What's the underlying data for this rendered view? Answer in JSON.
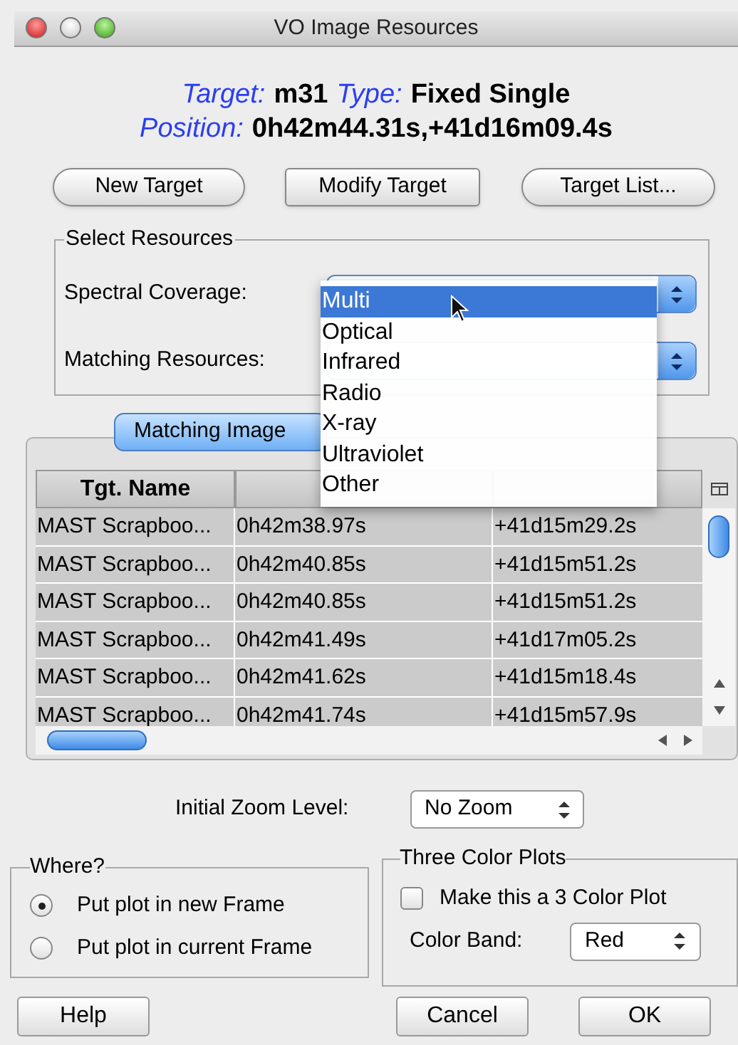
{
  "window": {
    "title": "VO Image Resources"
  },
  "info_lines": [
    [
      {
        "label": "Target:",
        "value": "m31"
      },
      {
        "label": "Type:",
        "value": "Fixed Single"
      }
    ],
    [
      {
        "label": "Position:",
        "value": "0h42m44.31s,+41d16m09.4s"
      }
    ]
  ],
  "target_buttons": [
    {
      "label": "New Target",
      "kind": "round"
    },
    {
      "label": "Modify Target",
      "kind": "square"
    },
    {
      "label": "Target List...",
      "kind": "round"
    }
  ],
  "select_resources": {
    "title": "Select Resources",
    "fields": [
      {
        "label": "Spectral Coverage:"
      },
      {
        "label": "Matching Resources:"
      }
    ]
  },
  "spectral_menu": {
    "items": [
      {
        "label": "Multi",
        "selected": true
      },
      {
        "label": "Optical",
        "selected": false
      },
      {
        "label": "Infrared",
        "selected": false
      },
      {
        "label": "Radio",
        "selected": false
      },
      {
        "label": "X-ray",
        "selected": false
      },
      {
        "label": "Ultraviolet",
        "selected": false
      },
      {
        "label": "Other",
        "selected": false
      }
    ]
  },
  "tabs": [
    {
      "label": "Matching Image",
      "selected": true
    }
  ],
  "table": {
    "columns": [
      "Tgt. Name"
    ],
    "rows": [
      [
        "MAST Scrapboo...",
        "0h42m38.97s",
        "+41d15m29.2s"
      ],
      [
        "MAST Scrapboo...",
        "0h42m40.85s",
        "+41d15m51.2s"
      ],
      [
        "MAST Scrapboo...",
        "0h42m40.85s",
        "+41d15m51.2s"
      ],
      [
        "MAST Scrapboo...",
        "0h42m41.49s",
        "+41d17m05.2s"
      ],
      [
        "MAST Scrapboo...",
        "0h42m41.62s",
        "+41d15m18.4s"
      ],
      [
        "MAST Scrapboo...",
        "0h42m41.74s",
        "+41d15m57.9s"
      ]
    ]
  },
  "zoom": {
    "label": "Initial Zoom Level:",
    "value": "No Zoom"
  },
  "where": {
    "title": "Where?",
    "options": [
      {
        "label": "Put plot in new Frame",
        "selected": true
      },
      {
        "label": "Put plot in current Frame",
        "selected": false
      }
    ]
  },
  "three_color": {
    "title": "Three Color Plots",
    "checkbox": {
      "label": "Make this a 3 Color Plot",
      "checked": false
    },
    "band": {
      "label": "Color Band:",
      "value": "Red"
    }
  },
  "dialog_buttons": [
    "Help",
    "Cancel",
    "OK"
  ]
}
